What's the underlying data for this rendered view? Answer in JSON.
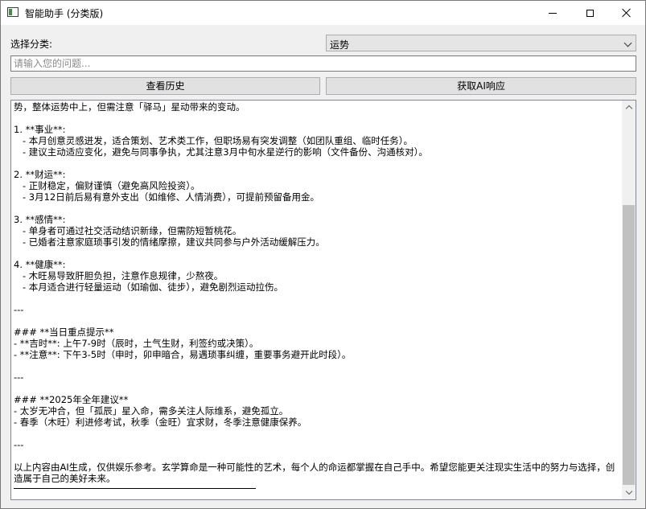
{
  "window": {
    "title": "智能助手 (分类版)",
    "icon": "app-window-icon",
    "controls": [
      "minimize-icon",
      "maximize-icon",
      "close-icon"
    ]
  },
  "form": {
    "category_label": "选择分类:",
    "category_selected": "运势",
    "question_placeholder": "请输入您的问题...",
    "question_value": ""
  },
  "buttons": {
    "history": "查看历史",
    "ai_response": "获取AI响应"
  },
  "response": {
    "lines": [
      "势，整体运势中上，但需注意「驿马」星动带来的变动。",
      "",
      "1. **事业**:",
      "   - 本月创意灵感迸发，适合策划、艺术类工作，但职场易有突发调整（如团队重组、临时任务）。",
      "   - 建议主动适应变化，避免与同事争执，尤其注意3月中旬水星逆行的影响（文件备份、沟通核对）。",
      "",
      "2. **财运**:",
      "   - 正财稳定，偏财谨慎（避免高风险投资）。",
      "   - 3月12日前后易有意外支出（如维修、人情消费），可提前预留备用金。",
      "",
      "3. **感情**:",
      "   - 单身者可通过社交活动结识新缘，但需防短暂桃花。",
      "   - 已婚者注意家庭琐事引发的情绪摩擦，建议共同参与户外活动缓解压力。",
      "",
      "4. **健康**:",
      "   - 木旺易导致肝胆负担，注意作息规律，少熬夜。",
      "   - 本月适合进行轻量运动（如瑜伽、徒步），避免剧烈运动拉伤。",
      "",
      "---",
      "",
      "### **当日重点提示**",
      "- **吉时**: 上午7-9时（辰时，土气生财，利签约或决策）。",
      "- **注意**: 下午3-5时（申时，卯申暗合，易遇琐事纠缠，重要事务避开此时段）。",
      "",
      "---",
      "",
      "### **2025年全年建议**",
      "- 太岁无冲合，但「孤辰」星入命，需多关注人际维系，避免孤立。",
      "- 春季（木旺）利进修考试，秋季（金旺）宜求财，冬季注意健康保养。",
      "",
      "---",
      "",
      "以上内容由AI生成，仅供娱乐参考。玄学算命是一种可能性的艺术，每个人的命运都掌握在自己手中。希望您能更关注现实生活中的努力与选择，创造属于自己的美好未来。"
    ]
  }
}
